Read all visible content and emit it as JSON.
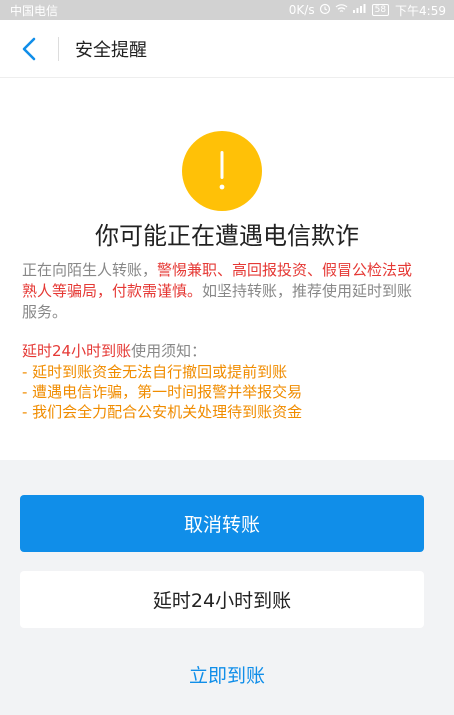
{
  "status_bar": {
    "carrier": "中国电信",
    "speed": "0K/s",
    "battery": "58",
    "time": "下午4:59"
  },
  "nav": {
    "title": "安全提醒"
  },
  "warning": {
    "headline": "你可能正在遭遇电信欺诈",
    "para_prefix": "正在向陌生人转账，",
    "para_red": "警惕兼职、高回报投资、假冒公检法或熟人等骗局，付款需谨慎。",
    "para_suffix": "如坚持转账，推荐使用延时到账服务。",
    "notice_red": "延时24小时到账",
    "notice_suffix": "使用须知：",
    "notice_items": [
      "- 延时到账资金无法自行撤回或提前到账",
      "- 遭遇电信诈骗，第一时间报警并举报交易",
      "- 我们会全力配合公安机关处理待到账资金"
    ]
  },
  "actions": {
    "cancel_label": "取消转账",
    "delay_label": "延时24小时到账",
    "instant_label": "立即到账"
  },
  "colors": {
    "accent": "#108ee9",
    "warning_icon": "#ffc107",
    "danger_text": "#e53935",
    "notice_text": "#f08c00"
  }
}
